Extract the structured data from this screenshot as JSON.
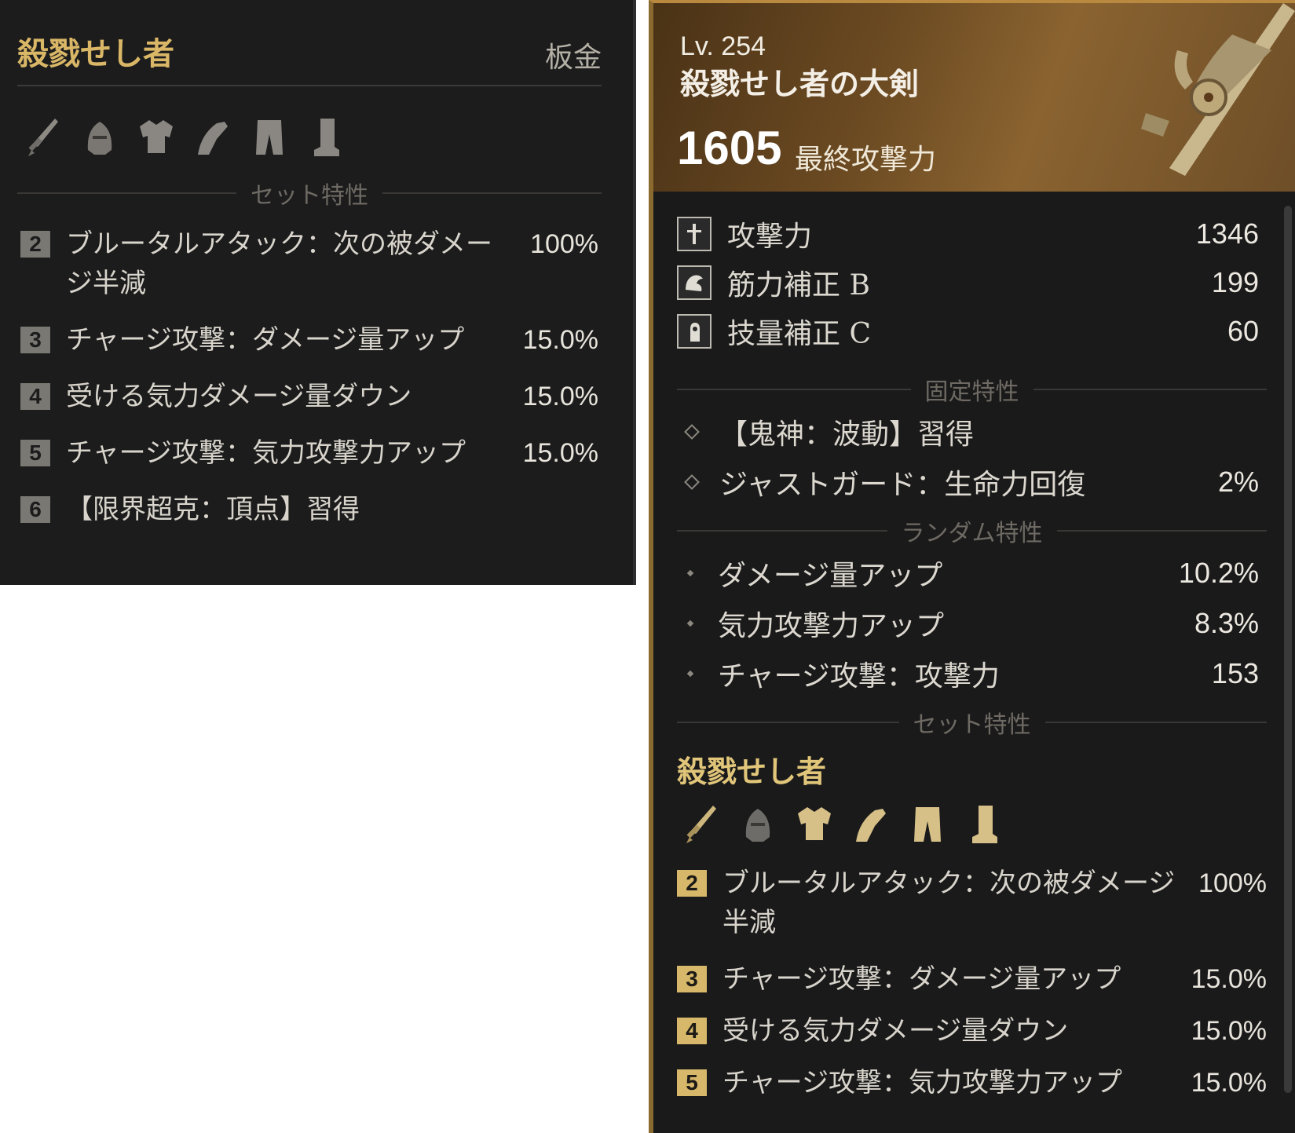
{
  "left_panel": {
    "set_name": "殺戮せし者",
    "category": "板金",
    "equipment_icons": [
      "sword-icon",
      "helmet-icon",
      "chest-armor-icon",
      "gauntlet-icon",
      "leg-armor-icon",
      "boots-icon"
    ],
    "set_section_label": "セット特性",
    "set_bonuses": [
      {
        "count": "2",
        "text": "ブルータルアタック：次の被ダメージ半減",
        "value": "100%"
      },
      {
        "count": "3",
        "text": "チャージ攻撃：ダメージ量アップ",
        "value": "15.0%"
      },
      {
        "count": "4",
        "text": "受ける気力ダメージ量ダウン",
        "value": "15.0%"
      },
      {
        "count": "5",
        "text": "チャージ攻撃：気力攻撃力アップ",
        "value": "15.0%"
      },
      {
        "count": "6",
        "text": "【限界超克：頂点】習得",
        "value": ""
      }
    ]
  },
  "right_panel": {
    "level": "Lv. 254",
    "item_name": "殺戮せし者の大剣",
    "final_attack_value": "1605",
    "final_attack_label": "最終攻撃力",
    "stats": [
      {
        "icon": "sword-stat-icon",
        "label": "攻撃力",
        "value": "1346"
      },
      {
        "icon": "strength-stat-icon",
        "label": "筋力補正 B",
        "value": "199"
      },
      {
        "icon": "dexterity-stat-icon",
        "label": "技量補正 C",
        "value": "60"
      }
    ],
    "fixed_traits_label": "固定特性",
    "fixed_traits": [
      {
        "text": "【鬼神：波動】習得",
        "value": ""
      },
      {
        "text": "ジャストガード：生命力回復",
        "value": "2%"
      }
    ],
    "random_traits_label": "ランダム特性",
    "random_traits": [
      {
        "text": "ダメージ量アップ",
        "value": "10.2%"
      },
      {
        "text": "気力攻撃力アップ",
        "value": "8.3%"
      },
      {
        "text": "チャージ攻撃：攻撃力",
        "value": "153"
      }
    ],
    "set_section_label": "セット特性",
    "set_name": "殺戮せし者",
    "set_bonuses": [
      {
        "count": "2",
        "text": "ブルータルアタック：次の被ダメージ半減",
        "value": "100%"
      },
      {
        "count": "3",
        "text": "チャージ攻撃：ダメージ量アップ",
        "value": "15.0%"
      },
      {
        "count": "4",
        "text": "受ける気力ダメージ量ダウン",
        "value": "15.0%"
      },
      {
        "count": "5",
        "text": "チャージ攻撃：気力攻撃力アップ",
        "value": "15.0%"
      }
    ]
  }
}
